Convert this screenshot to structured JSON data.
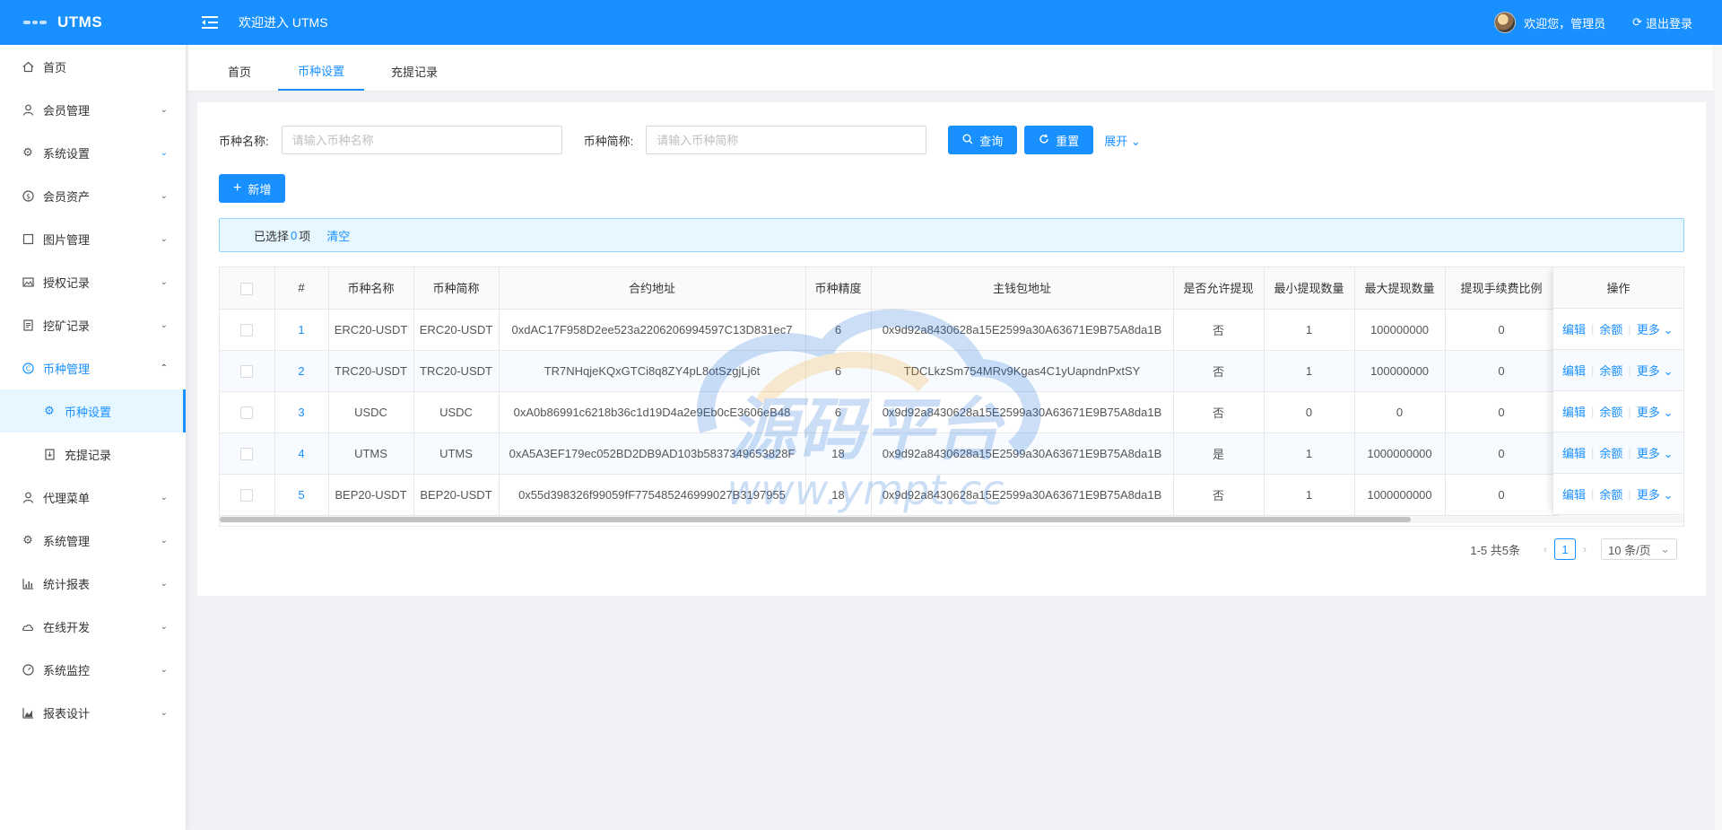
{
  "app": {
    "logo_text": "UTMS",
    "welcome_title": "欢迎进入 UTMS",
    "user_greeting": "欢迎您，管理员",
    "logout": "退出登录"
  },
  "sidebar": {
    "items": [
      {
        "label": "首页",
        "icon": "home-icon"
      },
      {
        "label": "会员管理",
        "icon": "user-icon"
      },
      {
        "label": "系统设置",
        "icon": "gear-icon"
      },
      {
        "label": "会员资产",
        "icon": "dollar-circle-icon"
      },
      {
        "label": "图片管理",
        "icon": "square-icon"
      },
      {
        "label": "授权记录",
        "icon": "picture-icon"
      },
      {
        "label": "挖矿记录",
        "icon": "document-icon"
      },
      {
        "label": "币种管理",
        "icon": "copyright-icon"
      },
      {
        "label": "币种设置",
        "icon": "gear-icon"
      },
      {
        "label": "充提记录",
        "icon": "file-down-icon"
      },
      {
        "label": "代理菜单",
        "icon": "user-icon"
      },
      {
        "label": "系统管理",
        "icon": "gear-icon"
      },
      {
        "label": "统计报表",
        "icon": "bar-chart-icon"
      },
      {
        "label": "在线开发",
        "icon": "cloud-icon"
      },
      {
        "label": "系统监控",
        "icon": "dashboard-icon"
      },
      {
        "label": "报表设计",
        "icon": "area-chart-icon"
      }
    ]
  },
  "tabs": [
    {
      "label": "首页"
    },
    {
      "label": "币种设置"
    },
    {
      "label": "充提记录"
    }
  ],
  "search": {
    "name_label": "币种名称:",
    "name_placeholder": "请输入币种名称",
    "short_label": "币种简称:",
    "short_placeholder": "请输入币种简称",
    "query": "查询",
    "reset": "重置",
    "expand": "展开"
  },
  "toolbar": {
    "add": "新增"
  },
  "selection": {
    "prefix": "已选择",
    "count": "0",
    "suffix": "项",
    "clear": "清空"
  },
  "table": {
    "columns": [
      "#",
      "币种名称",
      "币种简称",
      "合约地址",
      "币种精度",
      "主钱包地址",
      "是否允许提现",
      "最小提现数量",
      "最大提现数量",
      "提现手续费比例"
    ],
    "op_header": "操作",
    "op_labels": {
      "edit": "编辑",
      "balance": "余额",
      "more": "更多"
    },
    "rows": [
      [
        "1",
        "ERC20-USDT",
        "ERC20-USDT",
        "0xdAC17F958D2ee523a2206206994597C13D831ec7",
        "6",
        "0x9d92a8430628a15E2599a30A63671E9B75A8da1B",
        "否",
        "1",
        "100000000",
        "0"
      ],
      [
        "2",
        "TRC20-USDT",
        "TRC20-USDT",
        "TR7NHqjeKQxGTCi8q8ZY4pL8otSzgjLj6t",
        "6",
        "TDCLkzSm754MRv9Kgas4C1yUapndnPxtSY",
        "否",
        "1",
        "100000000",
        "0"
      ],
      [
        "3",
        "USDC",
        "USDC",
        "0xA0b86991c6218b36c1d19D4a2e9Eb0cE3606eB48",
        "6",
        "0x9d92a8430628a15E2599a30A63671E9B75A8da1B",
        "否",
        "0",
        "0",
        "0"
      ],
      [
        "4",
        "UTMS",
        "UTMS",
        "0xA5A3EF179ec052BD2DB9AD103b5837349653828F",
        "18",
        "0x9d92a8430628a15E2599a30A63671E9B75A8da1B",
        "是",
        "1",
        "1000000000",
        "0"
      ],
      [
        "5",
        "BEP20-USDT",
        "BEP20-USDT",
        "0x55d398326f99059fF775485246999027B3197955",
        "18",
        "0x9d92a8430628a15E2599a30A63671E9B75A8da1B",
        "否",
        "1",
        "1000000000",
        "0"
      ]
    ]
  },
  "pagination": {
    "total_text": "1-5 共5条",
    "current_page": "1",
    "page_size": "10 条/页"
  },
  "watermark": {
    "text_cn": "源码平台",
    "text_url": "www.ympt.cc"
  },
  "colors": {
    "primary": "#1890ff",
    "header_bg": "#1890ff",
    "active_bg": "#e6f7ff"
  }
}
